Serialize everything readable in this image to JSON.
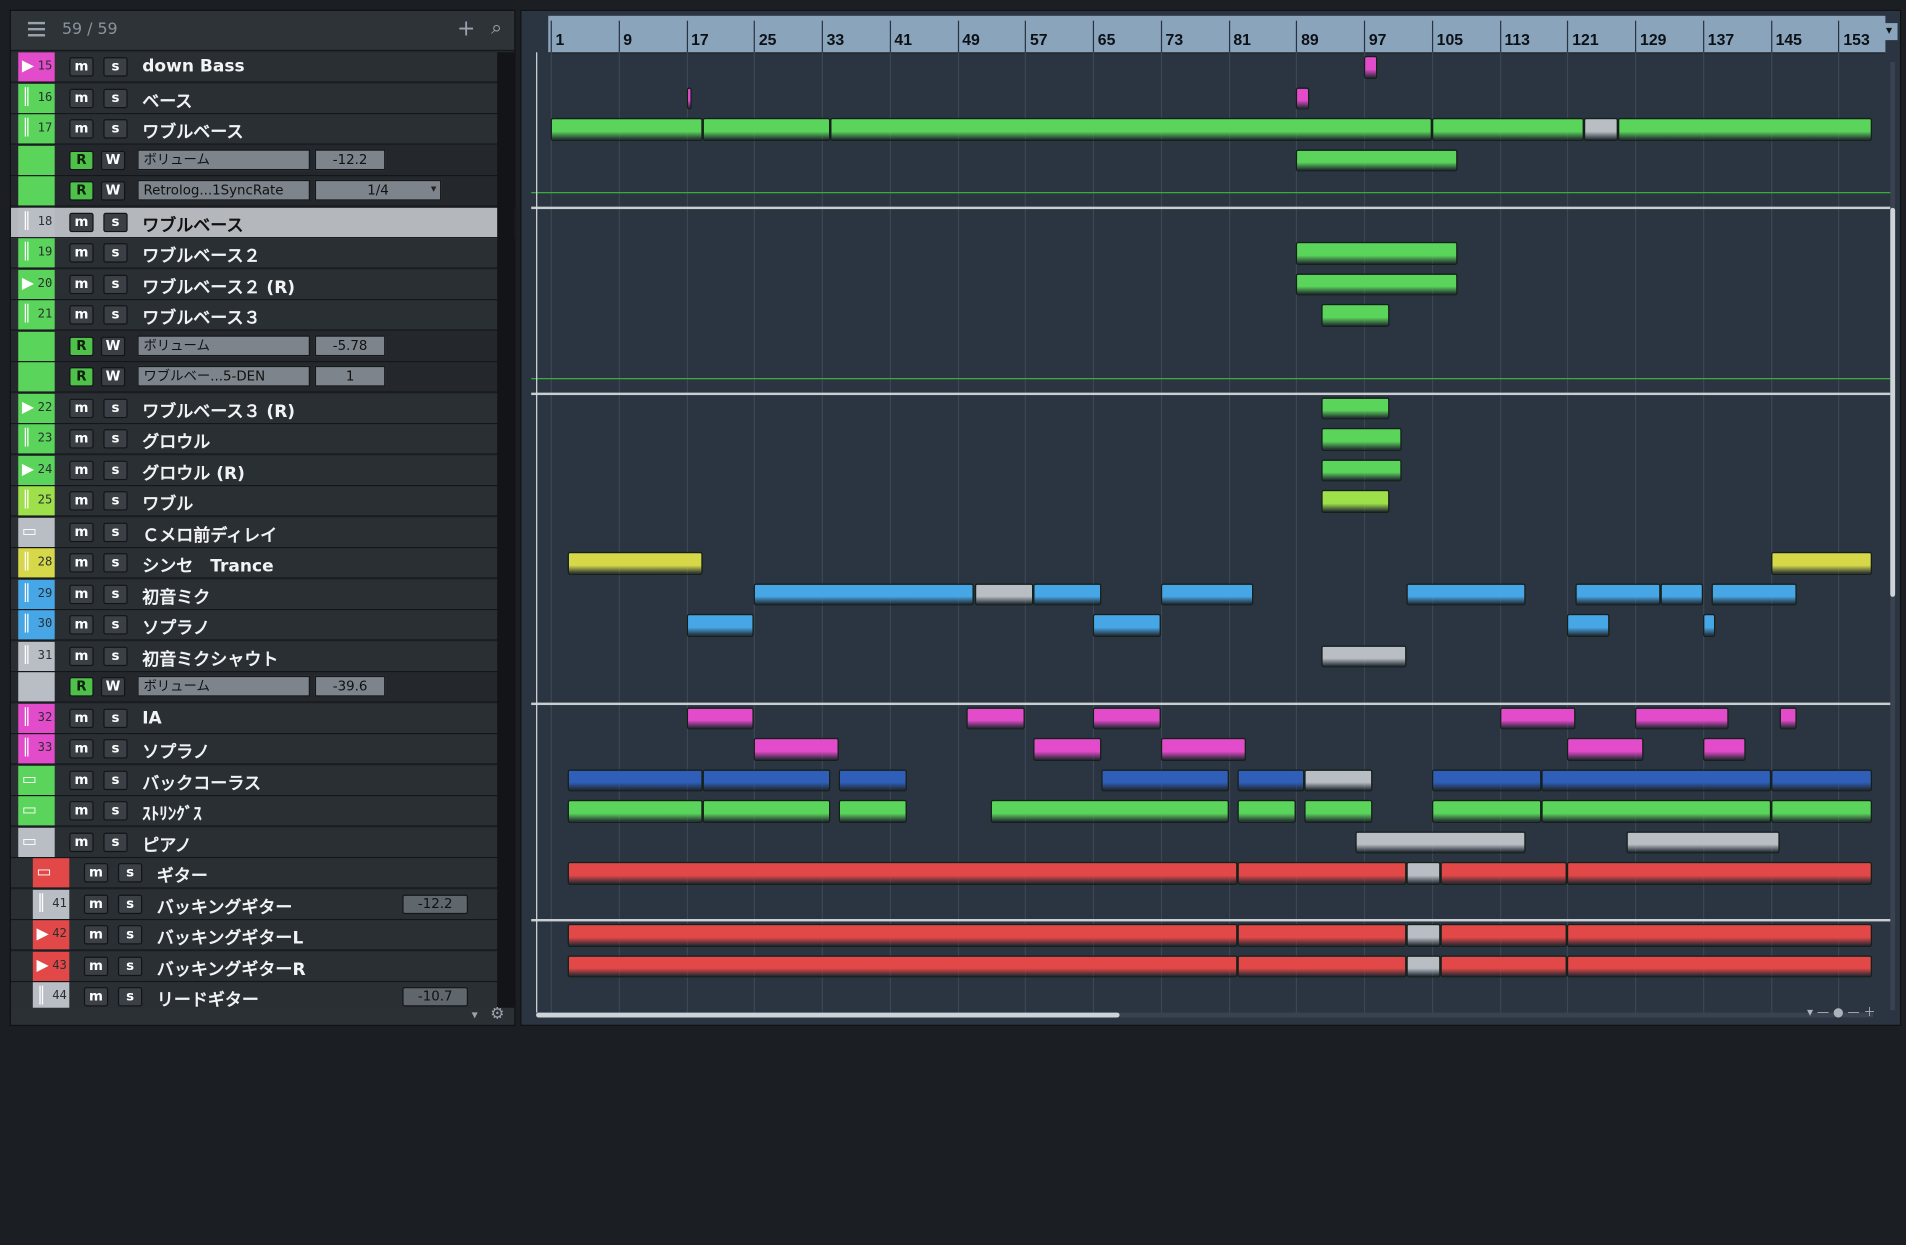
{
  "header": {
    "track_count": "59 / 59",
    "add_label": "+",
    "search_label": "⌕"
  },
  "colors": {
    "magenta": "#e24bc9",
    "green": "#5ad45a",
    "lime": "#9ee04a",
    "yellow": "#d6d84a",
    "blue": "#47a7e6",
    "gray": "#b9bec4",
    "red": "#e24848",
    "navy": "#2f5fb8",
    "panel": "#2b3441"
  },
  "tracks": [
    {
      "kind": "track",
      "num": "15",
      "icon": "▶",
      "color": "#e24bc9",
      "name": "down Bass"
    },
    {
      "kind": "track",
      "num": "16",
      "icon": "║",
      "color": "#5ad45a",
      "name": "ベース"
    },
    {
      "kind": "track",
      "num": "17",
      "icon": "║",
      "color": "#5ad45a",
      "name": "ワブルベース"
    },
    {
      "kind": "auto",
      "color": "#5ad45a",
      "param": "ボリューム",
      "value": "-12.2"
    },
    {
      "kind": "auto",
      "color": "#5ad45a",
      "param": "Retrolog...1SyncRate",
      "value": "1/4",
      "dropdown": true
    },
    {
      "kind": "track",
      "num": "18",
      "icon": "║",
      "color": "#b9bec4",
      "name": "ワブルベース",
      "selected": true
    },
    {
      "kind": "track",
      "num": "19",
      "icon": "║",
      "color": "#5ad45a",
      "name": "ワブルベース２"
    },
    {
      "kind": "track",
      "num": "20",
      "icon": "▶",
      "color": "#5ad45a",
      "name": "ワブルベース２ (R)"
    },
    {
      "kind": "track",
      "num": "21",
      "icon": "║",
      "color": "#5ad45a",
      "name": "ワブルベース３"
    },
    {
      "kind": "auto",
      "color": "#5ad45a",
      "param": "ボリューム",
      "value": "-5.78"
    },
    {
      "kind": "auto",
      "color": "#5ad45a",
      "param": "ワブルベー...5-DEN",
      "value": "1"
    },
    {
      "kind": "track",
      "num": "22",
      "icon": "▶",
      "color": "#5ad45a",
      "name": "ワブルベース３ (R)"
    },
    {
      "kind": "track",
      "num": "23",
      "icon": "║",
      "color": "#5ad45a",
      "name": "グロウル"
    },
    {
      "kind": "track",
      "num": "24",
      "icon": "▶",
      "color": "#5ad45a",
      "name": "グロウル (R)"
    },
    {
      "kind": "track",
      "num": "25",
      "icon": "║",
      "color": "#9ee04a",
      "name": "ワブル"
    },
    {
      "kind": "track",
      "num": "",
      "icon": "▭",
      "color": "#b9bec4",
      "name": "Ｃメロ前ディレイ"
    },
    {
      "kind": "track",
      "num": "28",
      "icon": "║",
      "color": "#d6d84a",
      "name": "シンセ　Trance"
    },
    {
      "kind": "track",
      "num": "29",
      "icon": "║",
      "color": "#47a7e6",
      "name": "初音ミク"
    },
    {
      "kind": "track",
      "num": "30",
      "icon": "║",
      "color": "#47a7e6",
      "name": "ソプラノ"
    },
    {
      "kind": "track",
      "num": "31",
      "icon": "║",
      "color": "#b9bec4",
      "name": "初音ミクシャウト"
    },
    {
      "kind": "auto",
      "color": "#b9bec4",
      "param": "ボリューム",
      "value": "-39.6"
    },
    {
      "kind": "track",
      "num": "32",
      "icon": "║",
      "color": "#e24bc9",
      "name": "IA"
    },
    {
      "kind": "track",
      "num": "33",
      "icon": "║",
      "color": "#e24bc9",
      "name": "ソプラノ"
    },
    {
      "kind": "track",
      "num": "",
      "icon": "▭",
      "color": "#5ad45a",
      "name": "バックコーラス"
    },
    {
      "kind": "track",
      "num": "",
      "icon": "▭",
      "color": "#5ad45a",
      "name": "ｽﾄﾘﾝｸﾞｽ"
    },
    {
      "kind": "track",
      "num": "",
      "icon": "▭",
      "color": "#b9bec4",
      "name": "ピアノ"
    },
    {
      "kind": "track",
      "num": "",
      "icon": "▭",
      "color": "#e24848",
      "name": "ギター",
      "indent": 12
    },
    {
      "kind": "track",
      "num": "41",
      "icon": "║",
      "color": "#b9bec4",
      "name": "バッキングギター",
      "indent": 12,
      "badge": "-12.2"
    },
    {
      "kind": "track",
      "num": "42",
      "icon": "▶",
      "color": "#e24848",
      "name": "バッキングギターL",
      "indent": 12
    },
    {
      "kind": "track",
      "num": "43",
      "icon": "▶",
      "color": "#e24848",
      "name": "バッキングギターR",
      "indent": 12
    },
    {
      "kind": "track",
      "num": "44",
      "icon": "║",
      "color": "#b9bec4",
      "name": "リードギター",
      "indent": 12,
      "badge": "-10.7"
    }
  ],
  "labels": {
    "m": "m",
    "s": "s",
    "r": "R",
    "w": "W"
  },
  "ruler": {
    "bars": [
      "1",
      "9",
      "17",
      "25",
      "33",
      "41",
      "49",
      "57",
      "65",
      "73",
      "81",
      "89",
      "97",
      "105",
      "113",
      "121",
      "129",
      "137",
      "145",
      "153"
    ]
  },
  "arrangement": {
    "clips": [
      {
        "lane": 0,
        "start": 97,
        "end": 98.5,
        "color": "#e24bc9"
      },
      {
        "lane": 1,
        "start": 17,
        "end": 17.6,
        "color": "#e24bc9"
      },
      {
        "lane": 1,
        "start": 89,
        "end": 90.5,
        "color": "#e24bc9"
      },
      {
        "lane": 2,
        "start": 1,
        "end": 19,
        "color": "#5ad45a"
      },
      {
        "lane": 2,
        "start": 19,
        "end": 34,
        "color": "#5ad45a"
      },
      {
        "lane": 2,
        "start": 34,
        "end": 105,
        "color": "#5ad45a"
      },
      {
        "lane": 2,
        "start": 105,
        "end": 123,
        "color": "#5ad45a"
      },
      {
        "lane": 2,
        "start": 123,
        "end": 127,
        "color": "#b9bec4"
      },
      {
        "lane": 2,
        "start": 127,
        "end": 157,
        "color": "#5ad45a"
      },
      {
        "lane": 3,
        "start": 89,
        "end": 108,
        "color": "#5ad45a"
      },
      {
        "lane": 6,
        "start": 89,
        "end": 108,
        "color": "#5ad45a"
      },
      {
        "lane": 7,
        "start": 89,
        "end": 108,
        "color": "#5ad45a"
      },
      {
        "lane": 8,
        "start": 92,
        "end": 100,
        "color": "#5ad45a"
      },
      {
        "lane": 11,
        "start": 92,
        "end": 100,
        "color": "#5ad45a"
      },
      {
        "lane": 12,
        "start": 92,
        "end": 101.5,
        "color": "#5ad45a"
      },
      {
        "lane": 13,
        "start": 92,
        "end": 101.5,
        "color": "#5ad45a"
      },
      {
        "lane": 14,
        "start": 92,
        "end": 100,
        "color": "#9ee04a"
      },
      {
        "lane": 16,
        "start": 3,
        "end": 19,
        "color": "#d6d84a"
      },
      {
        "lane": 16,
        "start": 145,
        "end": 157,
        "color": "#d6d84a"
      },
      {
        "lane": 17,
        "start": 25,
        "end": 51,
        "color": "#47a7e6"
      },
      {
        "lane": 17,
        "start": 51,
        "end": 58,
        "color": "#b9bec4"
      },
      {
        "lane": 17,
        "start": 58,
        "end": 66,
        "color": "#47a7e6"
      },
      {
        "lane": 17,
        "start": 73,
        "end": 84,
        "color": "#47a7e6"
      },
      {
        "lane": 17,
        "start": 102,
        "end": 116,
        "color": "#47a7e6"
      },
      {
        "lane": 17,
        "start": 122,
        "end": 132,
        "color": "#47a7e6"
      },
      {
        "lane": 17,
        "start": 132,
        "end": 137,
        "color": "#47a7e6"
      },
      {
        "lane": 17,
        "start": 138,
        "end": 148,
        "color": "#47a7e6"
      },
      {
        "lane": 18,
        "start": 17,
        "end": 25,
        "color": "#47a7e6"
      },
      {
        "lane": 18,
        "start": 65,
        "end": 73,
        "color": "#47a7e6"
      },
      {
        "lane": 18,
        "start": 121,
        "end": 126,
        "color": "#47a7e6"
      },
      {
        "lane": 18,
        "start": 137,
        "end": 138.5,
        "color": "#47a7e6"
      },
      {
        "lane": 19,
        "start": 92,
        "end": 102,
        "color": "#b9bec4"
      },
      {
        "lane": 21,
        "start": 17,
        "end": 25,
        "color": "#e24bc9"
      },
      {
        "lane": 21,
        "start": 50,
        "end": 57,
        "color": "#e24bc9"
      },
      {
        "lane": 21,
        "start": 65,
        "end": 73,
        "color": "#e24bc9"
      },
      {
        "lane": 21,
        "start": 113,
        "end": 122,
        "color": "#e24bc9"
      },
      {
        "lane": 21,
        "start": 129,
        "end": 140,
        "color": "#e24bc9"
      },
      {
        "lane": 21,
        "start": 146,
        "end": 148,
        "color": "#e24bc9"
      },
      {
        "lane": 22,
        "start": 25,
        "end": 35,
        "color": "#e24bc9"
      },
      {
        "lane": 22,
        "start": 58,
        "end": 66,
        "color": "#e24bc9"
      },
      {
        "lane": 22,
        "start": 73,
        "end": 83,
        "color": "#e24bc9"
      },
      {
        "lane": 22,
        "start": 121,
        "end": 130,
        "color": "#e24bc9"
      },
      {
        "lane": 22,
        "start": 137,
        "end": 142,
        "color": "#e24bc9"
      },
      {
        "lane": 23,
        "start": 3,
        "end": 19,
        "color": "#2f5fb8"
      },
      {
        "lane": 23,
        "start": 19,
        "end": 34,
        "color": "#2f5fb8"
      },
      {
        "lane": 23,
        "start": 35,
        "end": 43,
        "color": "#2f5fb8"
      },
      {
        "lane": 23,
        "start": 66,
        "end": 81,
        "color": "#2f5fb8"
      },
      {
        "lane": 23,
        "start": 82,
        "end": 90,
        "color": "#2f5fb8"
      },
      {
        "lane": 23,
        "start": 90,
        "end": 98,
        "color": "#b9bec4"
      },
      {
        "lane": 23,
        "start": 105,
        "end": 118,
        "color": "#2f5fb8"
      },
      {
        "lane": 23,
        "start": 118,
        "end": 145,
        "color": "#2f5fb8"
      },
      {
        "lane": 23,
        "start": 145,
        "end": 157,
        "color": "#2f5fb8"
      },
      {
        "lane": 24,
        "start": 3,
        "end": 19,
        "color": "#5ad45a"
      },
      {
        "lane": 24,
        "start": 19,
        "end": 34,
        "color": "#5ad45a"
      },
      {
        "lane": 24,
        "start": 35,
        "end": 43,
        "color": "#5ad45a"
      },
      {
        "lane": 24,
        "start": 53,
        "end": 81,
        "color": "#5ad45a"
      },
      {
        "lane": 24,
        "start": 82,
        "end": 89,
        "color": "#5ad45a"
      },
      {
        "lane": 24,
        "start": 90,
        "end": 98,
        "color": "#5ad45a"
      },
      {
        "lane": 24,
        "start": 105,
        "end": 118,
        "color": "#5ad45a"
      },
      {
        "lane": 24,
        "start": 118,
        "end": 145,
        "color": "#5ad45a"
      },
      {
        "lane": 24,
        "start": 145,
        "end": 157,
        "color": "#5ad45a"
      },
      {
        "lane": 25,
        "start": 96,
        "end": 116,
        "color": "#b9bec4"
      },
      {
        "lane": 25,
        "start": 128,
        "end": 146,
        "color": "#b9bec4"
      },
      {
        "lane": 26,
        "start": 3,
        "end": 82,
        "color": "#e24848"
      },
      {
        "lane": 26,
        "start": 82,
        "end": 102,
        "color": "#e24848"
      },
      {
        "lane": 26,
        "start": 102,
        "end": 106,
        "color": "#b9bec4"
      },
      {
        "lane": 26,
        "start": 106,
        "end": 121,
        "color": "#e24848"
      },
      {
        "lane": 26,
        "start": 121,
        "end": 157,
        "color": "#e24848"
      },
      {
        "lane": 28,
        "start": 3,
        "end": 82,
        "color": "#e24848"
      },
      {
        "lane": 28,
        "start": 82,
        "end": 102,
        "color": "#e24848"
      },
      {
        "lane": 28,
        "start": 102,
        "end": 106,
        "color": "#b9bec4"
      },
      {
        "lane": 28,
        "start": 106,
        "end": 121,
        "color": "#e24848"
      },
      {
        "lane": 28,
        "start": 121,
        "end": 157,
        "color": "#e24848"
      },
      {
        "lane": 29,
        "start": 3,
        "end": 82,
        "color": "#e24848"
      },
      {
        "lane": 29,
        "start": 82,
        "end": 102,
        "color": "#e24848"
      },
      {
        "lane": 29,
        "start": 102,
        "end": 106,
        "color": "#b9bec4"
      },
      {
        "lane": 29,
        "start": 106,
        "end": 121,
        "color": "#e24848"
      },
      {
        "lane": 29,
        "start": 121,
        "end": 157,
        "color": "#e24848"
      }
    ],
    "separators_after_lanes": [
      4,
      10,
      20,
      27
    ],
    "automation_lanes": [
      4,
      10
    ]
  }
}
